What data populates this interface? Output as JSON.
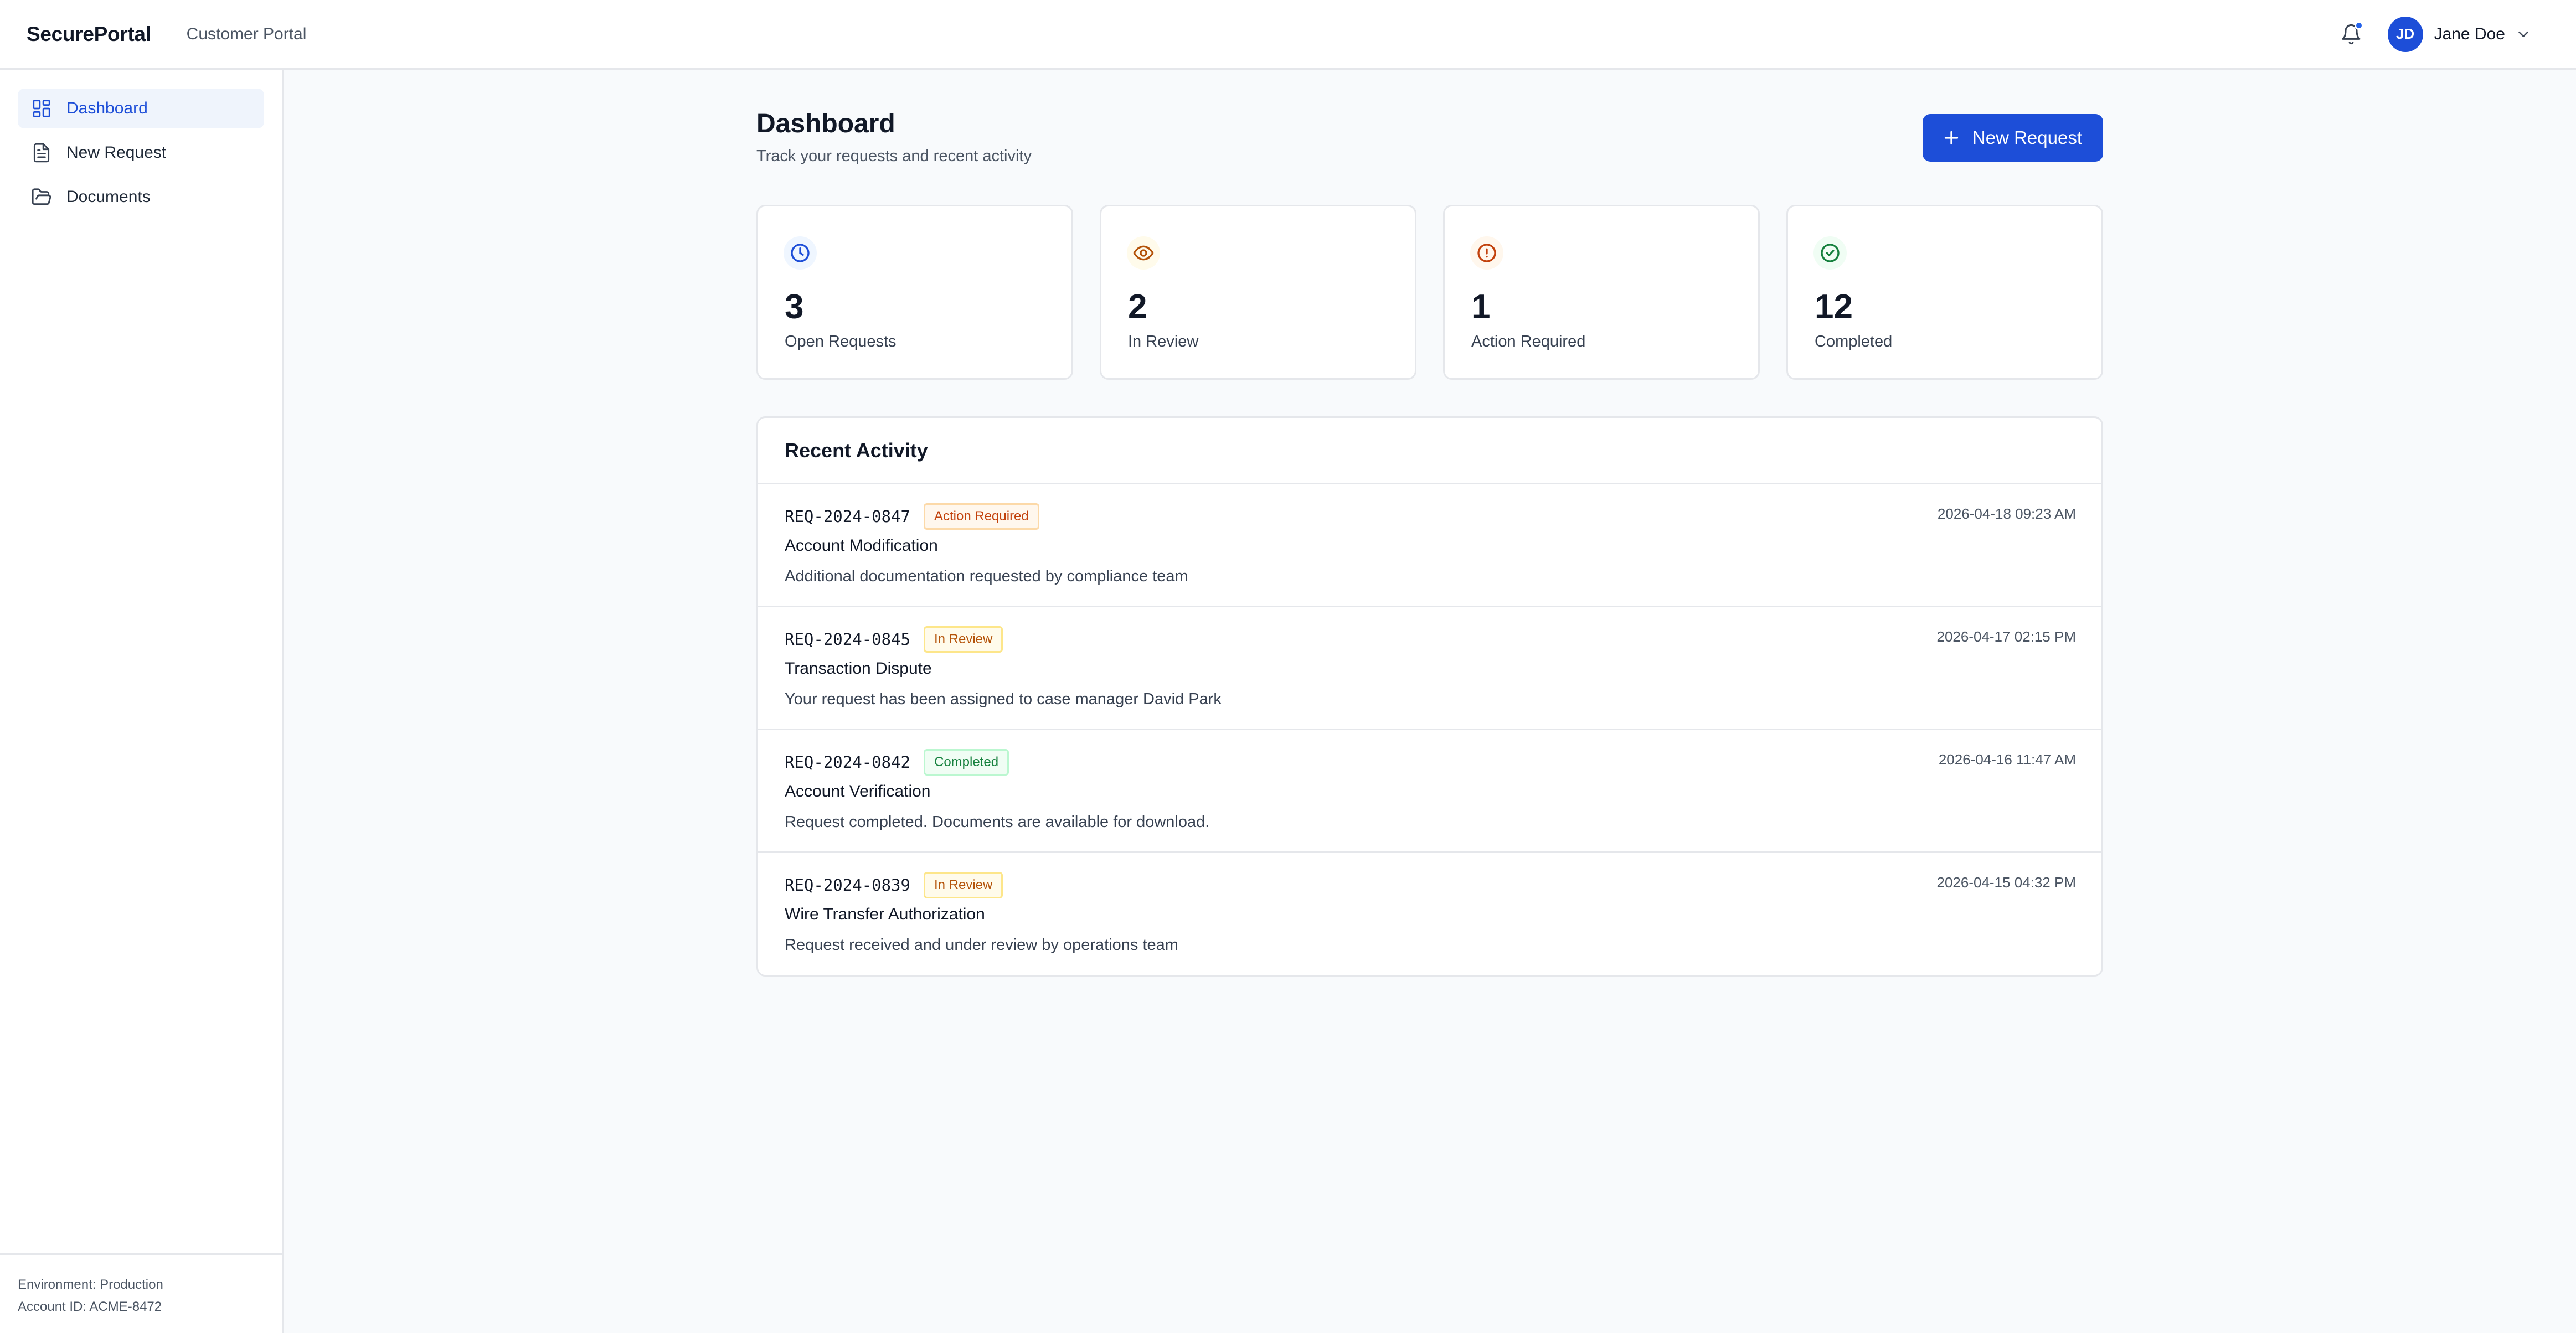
{
  "header": {
    "brand": "SecurePortal",
    "subtitle": "Customer Portal",
    "user": {
      "initials": "JD",
      "name": "Jane Doe"
    },
    "accent_color": "#1d4ed8"
  },
  "sidebar": {
    "items": [
      {
        "label": "Dashboard",
        "icon": "grid-icon",
        "active": true
      },
      {
        "label": "New Request",
        "icon": "file-text-icon",
        "active": false
      },
      {
        "label": "Documents",
        "icon": "folder-open-icon",
        "active": false
      }
    ],
    "footer": {
      "environment": "Environment: Production",
      "account": "Account ID: ACME-8472"
    }
  },
  "main": {
    "title": "Dashboard",
    "subtitle": "Track your requests and recent activity",
    "new_request_label": "New Request",
    "stats": [
      {
        "value": "3",
        "label": "Open Requests",
        "icon": "clock-icon",
        "color": "#1d4ed8"
      },
      {
        "value": "2",
        "label": "In Review",
        "icon": "eye-icon",
        "color": "#b45309"
      },
      {
        "value": "1",
        "label": "Action Required",
        "icon": "alert-circle-icon",
        "color": "#c2410c"
      },
      {
        "value": "12",
        "label": "Completed",
        "icon": "check-circle-icon",
        "color": "#15803d"
      }
    ],
    "activity": {
      "title": "Recent Activity",
      "rows": [
        {
          "id": "REQ-2024-0847",
          "status": "Action Required",
          "title": "Account Modification",
          "desc": "Additional documentation requested by compliance team",
          "time": "2026-04-18 09:23 AM"
        },
        {
          "id": "REQ-2024-0845",
          "status": "In Review",
          "title": "Transaction Dispute",
          "desc": "Your request has been assigned to case manager David Park",
          "time": "2026-04-17 02:15 PM"
        },
        {
          "id": "REQ-2024-0842",
          "status": "Completed",
          "title": "Account Verification",
          "desc": "Request completed. Documents are available for download.",
          "time": "2026-04-16 11:47 AM"
        },
        {
          "id": "REQ-2024-0839",
          "status": "In Review",
          "title": "Wire Transfer Authorization",
          "desc": "Request received and under review by operations team",
          "time": "2026-04-15 04:32 PM"
        }
      ]
    }
  }
}
